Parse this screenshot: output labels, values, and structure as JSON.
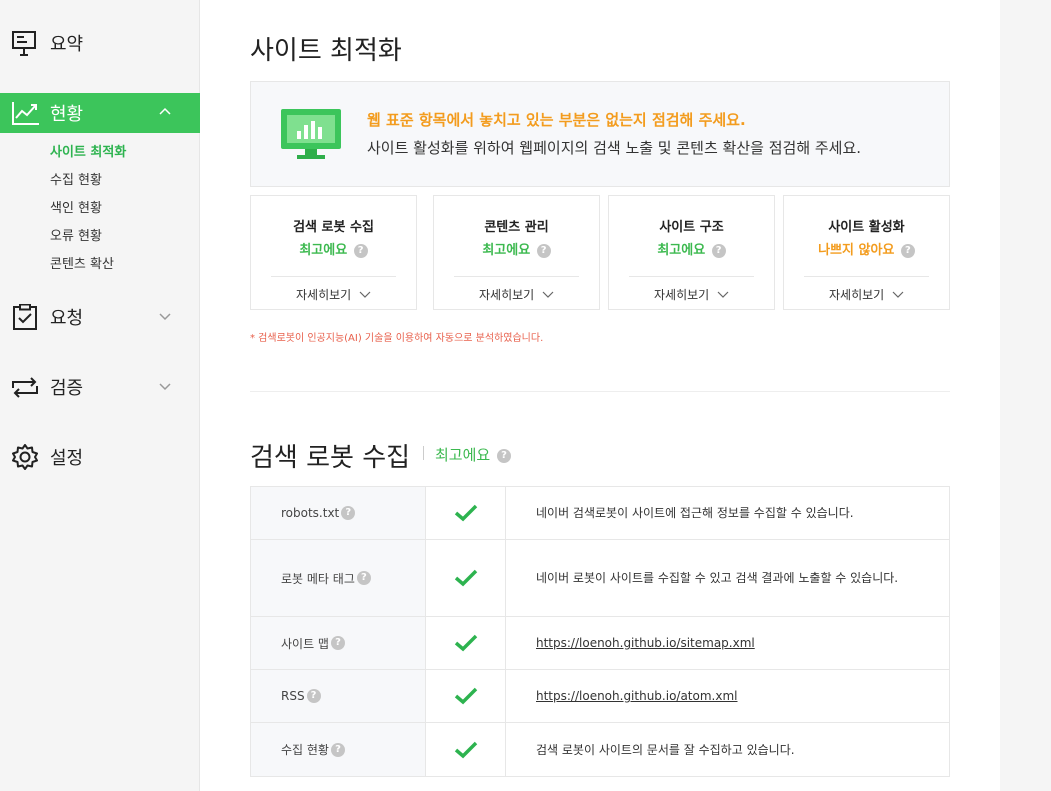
{
  "sidebar": {
    "items": [
      {
        "label": "요약",
        "icon": "presentation-board-icon"
      },
      {
        "label": "현황",
        "icon": "line-chart-icon"
      },
      {
        "label": "요청",
        "icon": "clipboard-check-icon"
      },
      {
        "label": "검증",
        "icon": "repeat-arrows-icon"
      },
      {
        "label": "설정",
        "icon": "gear-icon"
      }
    ],
    "subitems": [
      "사이트 최적화",
      "수집 현황",
      "색인 현황",
      "오류 현황",
      "콘텐츠 확산"
    ],
    "accent": "#3cc55b"
  },
  "main": {
    "title": "사이트 최적화",
    "banner": {
      "headline": "웹 표준 항목에서 놓치고 있는 부분은 없는지 점검해 주세요.",
      "sub": "사이트 활성화를 위하여 웹페이지의 검색 노출 및 콘텐츠 확산을 점검해 주세요."
    },
    "cards": [
      {
        "title": "검색 로봇 수집",
        "status": "최고에요",
        "status_color": "#3cb94f",
        "more": "자세히보기"
      },
      {
        "title": "콘텐츠 관리",
        "status": "최고에요",
        "status_color": "#3cb94f",
        "more": "자세히보기"
      },
      {
        "title": "사이트 구조",
        "status": "최고에요",
        "status_color": "#3cb94f",
        "more": "자세히보기"
      },
      {
        "title": "사이트 활성화",
        "status": "나쁘지 않아요",
        "status_color": "#f39c1e",
        "more": "자세히보기"
      }
    ],
    "note": "* 검색로봇이 인공지능(AI) 기술을 이용하여 자동으로 분석하였습니다.",
    "section": {
      "title": "검색 로봇 수집",
      "status": "최고에요",
      "rows": [
        {
          "name": "robots.txt",
          "desc": "네이버 검색로봇이 사이트에 접근해 정보를 수집할 수 있습니다.",
          "link": false
        },
        {
          "name": "로봇 메타 태그",
          "desc": "네이버 로봇이 사이트를 수집할 수 있고 검색 결과에 노출할 수 있습니다.",
          "link": false
        },
        {
          "name": "사이트 맵",
          "desc": "https://loenoh.github.io/sitemap.xml",
          "link": true
        },
        {
          "name": "RSS",
          "desc": "https://loenoh.github.io/atom.xml",
          "link": true
        },
        {
          "name": "수집 현황",
          "desc": "검색 로봇이 사이트의 문서를 잘 수집하고 있습니다.",
          "link": false
        }
      ]
    }
  }
}
